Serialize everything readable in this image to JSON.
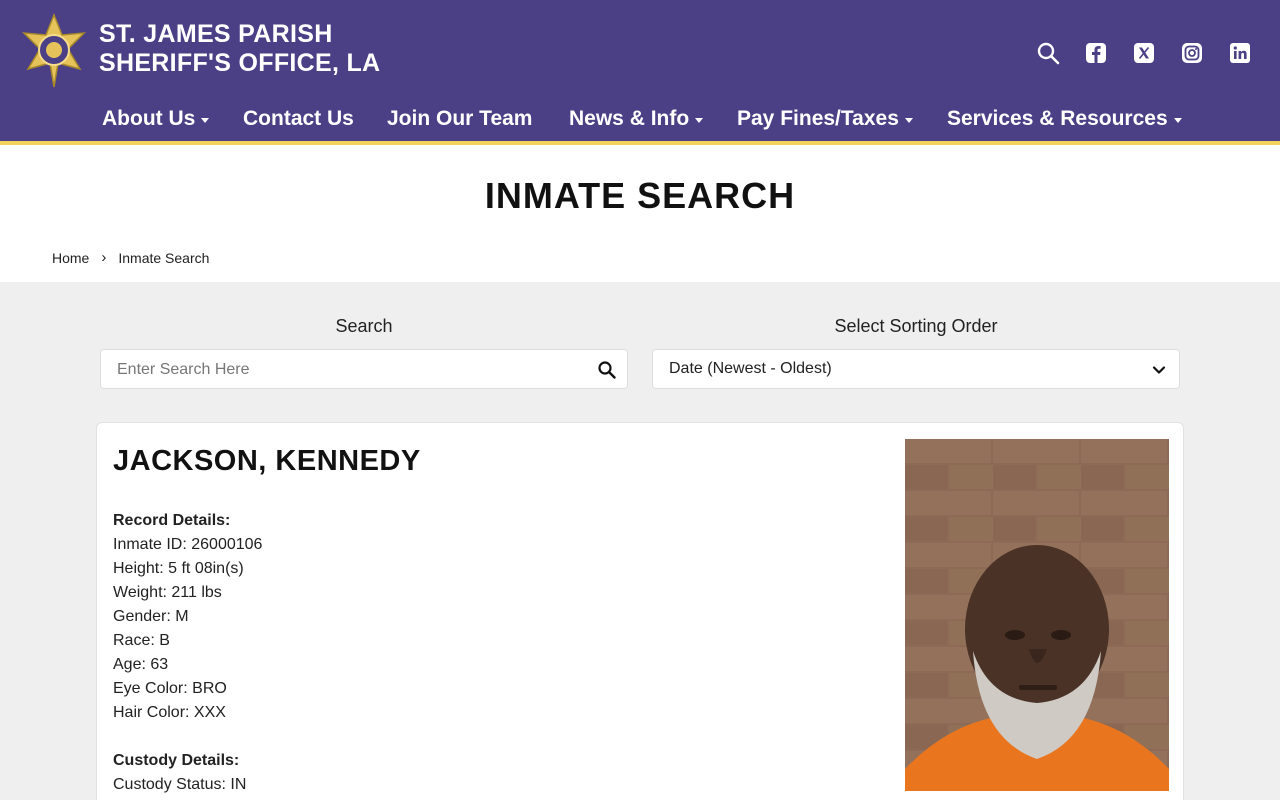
{
  "header": {
    "brand_line1": "ST. JAMES PARISH",
    "brand_line2": "SHERIFF'S OFFICE, LA",
    "icons": [
      "search-icon",
      "facebook-icon",
      "x-icon",
      "instagram-icon",
      "linkedin-icon"
    ],
    "colors": {
      "primary": "#4b3f86",
      "accent": "#f1d25c"
    }
  },
  "nav": [
    {
      "label": "About Us",
      "dropdown": true
    },
    {
      "label": "Contact Us",
      "dropdown": false
    },
    {
      "label": "Join Our Team",
      "dropdown": false
    },
    {
      "label": "News & Info",
      "dropdown": true
    },
    {
      "label": "Pay Fines/Taxes",
      "dropdown": true
    },
    {
      "label": "Services & Resources",
      "dropdown": true
    }
  ],
  "page": {
    "title": "INMATE SEARCH",
    "breadcrumb": {
      "home": "Home",
      "separator": "›",
      "current": "Inmate Search"
    }
  },
  "search": {
    "label": "Search",
    "placeholder": "Enter Search Here",
    "value": ""
  },
  "sort": {
    "label": "Select Sorting Order",
    "selected": "Date (Newest - Oldest)"
  },
  "inmate": {
    "name": "JACKSON, KENNEDY",
    "record_heading": "Record Details:",
    "record": [
      "Inmate ID: 26000106",
      "Height: 5 ft 08in(s)",
      "Weight: 211 lbs",
      "Gender: M",
      "Race: B",
      "Age: 63",
      "Eye Color: BRO",
      "Hair Color: XXX"
    ],
    "custody_heading": "Custody Details:",
    "custody": [
      "Custody Status: IN"
    ]
  }
}
